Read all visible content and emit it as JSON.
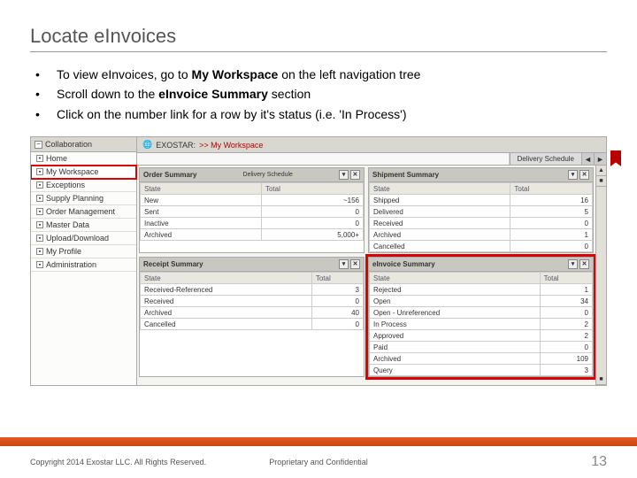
{
  "title": "Locate eInvoices",
  "bullets": [
    {
      "pre": "To view eInvoices, go to ",
      "bold": "My Workspace",
      "post": " on the left navigation tree"
    },
    {
      "pre": "Scroll down to the ",
      "bold": "eInvoice Summary",
      "post": " section"
    },
    {
      "pre": "Click on the number link for a row by it's status (i.e. 'In Process')",
      "bold": "",
      "post": ""
    }
  ],
  "sidebar": {
    "header": "Collaboration",
    "items": [
      "Home",
      "My Workspace",
      "Exceptions",
      "Supply Planning",
      "Order Management",
      "Master Data",
      "Upload/Download",
      "My Profile",
      "Administration"
    ],
    "highlightIndex": 1
  },
  "breadcrumb": {
    "prefix": "EXOSTAR:",
    "page": ">> My Workspace"
  },
  "topTab": "Delivery Schedule",
  "panels": {
    "orderSummary": {
      "title": "Order Summary",
      "subhead": "Delivery Schedule",
      "cols": [
        "State",
        "Total"
      ],
      "rows": [
        [
          "New",
          "~156"
        ],
        [
          "Sent",
          "0"
        ],
        [
          "Inactive",
          "0"
        ],
        [
          "Archived",
          "5,000+"
        ]
      ]
    },
    "shipmentSummary": {
      "title": "Shipment Summary",
      "cols": [
        "State",
        "Total"
      ],
      "rows": [
        [
          "Shipped",
          "16"
        ],
        [
          "Delivered",
          "5"
        ],
        [
          "Received",
          "0"
        ],
        [
          "Archived",
          "1"
        ],
        [
          "Cancelled",
          "0"
        ]
      ]
    },
    "receiptSummary": {
      "title": "Receipt Summary",
      "cols": [
        "State",
        "Total"
      ],
      "rows": [
        [
          "Received-Referenced",
          "3"
        ],
        [
          "Received",
          "0"
        ],
        [
          "Archived",
          "40"
        ],
        [
          "Cancelled",
          "0"
        ]
      ]
    },
    "einvoiceSummary": {
      "title": "eInvoice Summary",
      "cols": [
        "State",
        "Total"
      ],
      "rows": [
        [
          "Rejected",
          "1"
        ],
        [
          "Open",
          "34"
        ],
        [
          "Open - Unreferenced",
          "0"
        ],
        [
          "In Process",
          "2"
        ],
        [
          "Approved",
          "2"
        ],
        [
          "Paid",
          "0"
        ],
        [
          "Archived",
          "109"
        ],
        [
          "Query",
          "3"
        ]
      ]
    }
  },
  "footer": {
    "left": "Copyright 2014 Exostar LLC. All Rights Reserved.",
    "mid": "Proprietary and Confidential",
    "page": "13"
  }
}
